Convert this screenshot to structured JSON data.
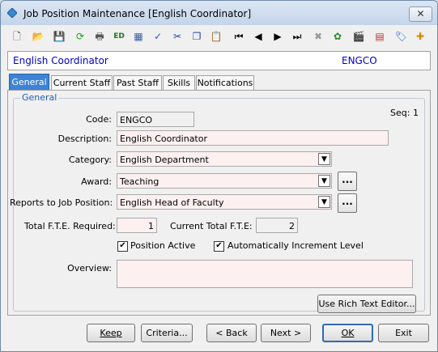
{
  "window": {
    "title": "Job Position Maintenance  [English Coordinator]",
    "close_glyph": "✕"
  },
  "header": {
    "name": "English Coordinator",
    "code": "ENGCO"
  },
  "tabs": [
    {
      "label": "General"
    },
    {
      "label": "Current Staff"
    },
    {
      "label": "Past Staff"
    },
    {
      "label": "Skills"
    },
    {
      "label": "Notifications"
    }
  ],
  "group": {
    "legend": "General"
  },
  "seq": {
    "label": "Seq:",
    "value": "1"
  },
  "form": {
    "code_label": "Code:",
    "code_value": "ENGCO",
    "description_label": "Description:",
    "description_value": "English Coordinator",
    "category_label": "Category:",
    "category_value": "English Department",
    "award_label": "Award:",
    "award_value": "Teaching",
    "reports_label": "Reports to Job Position:",
    "reports_value": "English Head of Faculty",
    "fte_label": "Total F.T.E. Required:",
    "fte_value": "1",
    "current_fte_label": "Current Total F.T.E:",
    "current_fte_value": "2",
    "position_active_label": "Position Active",
    "position_active_checked": true,
    "auto_increment_label": "Automatically Increment Level",
    "auto_increment_checked": true,
    "overview_label": "Overview:",
    "overview_value": "",
    "ellipsis": "...",
    "dropdown_glyph": "▼",
    "check_glyph": "✔"
  },
  "buttons": {
    "rich_text": "Use Rich Text Editor...",
    "keep": "Keep",
    "criteria": "Criteria...",
    "back": "< Back",
    "next": "Next >",
    "ok": "OK",
    "exit": "Exit"
  },
  "toolbar": [
    {
      "icon": "new-document-icon",
      "glyph": "🗋",
      "color": "#333333"
    },
    {
      "icon": "open-folder-icon",
      "glyph": "📂",
      "color": "#d9a400"
    },
    {
      "icon": "save-icon",
      "glyph": "💾",
      "color": "#888888"
    },
    {
      "icon": "refresh-icon",
      "glyph": "⟳",
      "color": "#1a9a1a"
    },
    {
      "icon": "print-icon",
      "glyph": "🖶",
      "color": "#555555"
    },
    {
      "icon": "edit-icon",
      "glyph": "ED",
      "color": "#1a7a1a"
    },
    {
      "icon": "calculator-icon",
      "glyph": "▦",
      "color": "#3a5fa0"
    },
    {
      "icon": "spellcheck-icon",
      "glyph": "✓",
      "color": "#2255cc"
    },
    {
      "icon": "cut-icon",
      "glyph": "✂",
      "color": "#2244aa"
    },
    {
      "icon": "copy-icon",
      "glyph": "❐",
      "color": "#2244aa"
    },
    {
      "icon": "paste-icon",
      "glyph": "📋",
      "color": "#b07a20"
    },
    {
      "icon": "first-record-icon",
      "glyph": "⏮",
      "color": "#000000"
    },
    {
      "icon": "previous-record-icon",
      "glyph": "◀",
      "color": "#000000"
    },
    {
      "icon": "next-record-icon",
      "glyph": "▶",
      "color": "#000000"
    },
    {
      "icon": "last-record-icon",
      "glyph": "⏭",
      "color": "#000000"
    },
    {
      "icon": "delete-icon",
      "glyph": "✖",
      "color": "#9a9a9a"
    },
    {
      "icon": "hierarchy-icon",
      "glyph": "✿",
      "color": "#2a8a2a"
    },
    {
      "icon": "clapperboard-icon",
      "glyph": "🎬",
      "color": "#333333"
    },
    {
      "icon": "printer-setup-icon",
      "glyph": "▤",
      "color": "#c03030"
    },
    {
      "icon": "tag-icon",
      "glyph": "🏷",
      "color": "#2266cc"
    },
    {
      "icon": "add-task-icon",
      "glyph": "✚",
      "color": "#d08a00"
    }
  ]
}
